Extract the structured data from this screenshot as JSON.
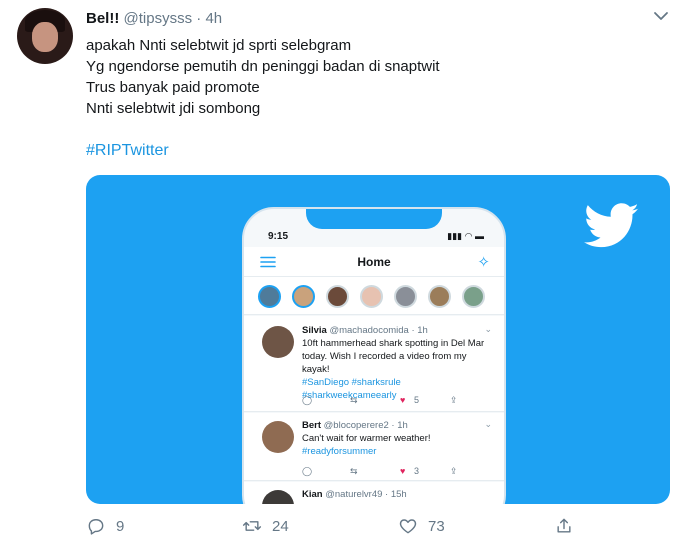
{
  "tweet": {
    "display_name": "Bel!!",
    "handle": "@tipsysss",
    "separator": "·",
    "time": "4h",
    "lines": [
      "apakah Nnti selebtwit jd sprti selebgram",
      "Yg ngendorse pemutih dn peninggi badan di snaptwit",
      "Trus banyak paid promote",
      "Nnti selebtwit jdi sombong"
    ],
    "hashtag": "#RIPTwitter"
  },
  "media": {
    "background_color": "#1da1f2",
    "phone": {
      "time": "9:15",
      "title": "Home",
      "tweets": [
        {
          "name": "Silvia",
          "handle": "@machadocomida · 1h",
          "text": "10ft hammerhead shark spotting in Del Mar today. Wish I recorded a video from my kayak!",
          "hashtags": "#SanDiego #sharksrule #sharkweekcameearly",
          "likes": "5"
        },
        {
          "name": "Bert",
          "handle": "@blocoperere2 · 1h",
          "text": "Can't wait for warmer weather!",
          "hashtags": "#readyforsummer",
          "likes": "3"
        },
        {
          "name": "Kian",
          "handle": "@naturelvr49 · 15h"
        }
      ]
    }
  },
  "actions": {
    "replies": "9",
    "retweets": "24",
    "likes": "73"
  },
  "colors": {
    "accent": "#1da1f2",
    "link": "#1b95e0",
    "secondary_text": "#657786",
    "like": "#e0245e"
  }
}
